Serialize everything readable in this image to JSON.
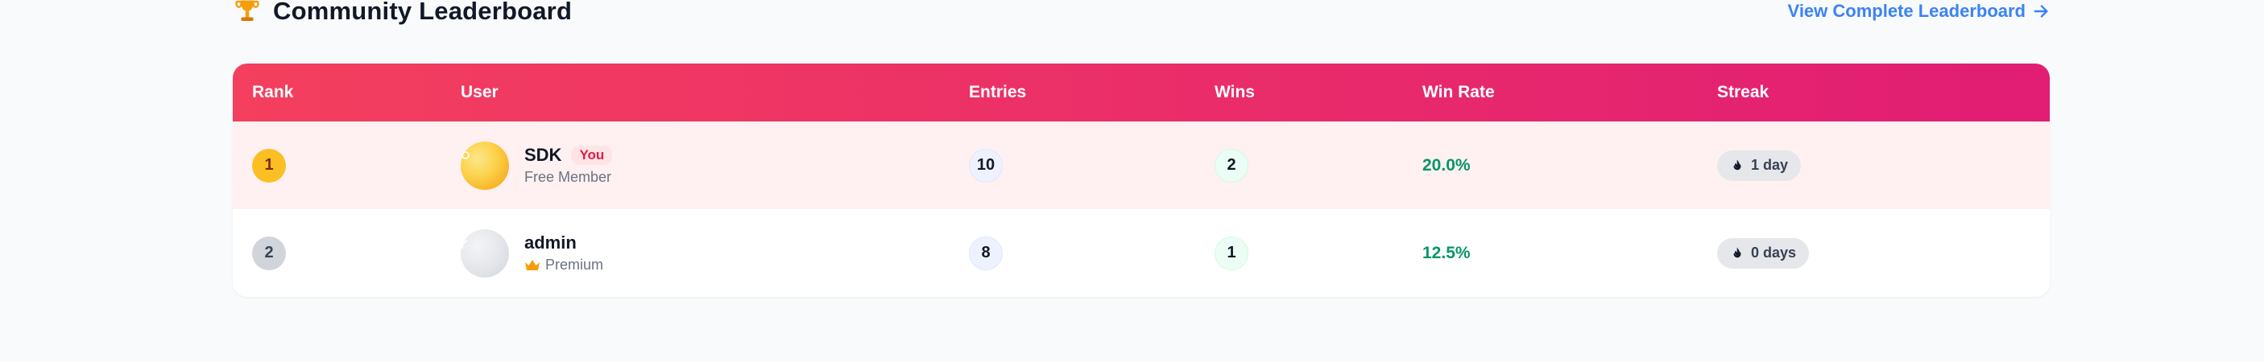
{
  "header": {
    "title": "Community Leaderboard",
    "view_all_label": "View Complete Leaderboard"
  },
  "table": {
    "columns": {
      "rank": "Rank",
      "user": "User",
      "entries": "Entries",
      "wins": "Wins",
      "win_rate": "Win Rate",
      "streak": "Streak"
    },
    "rows": [
      {
        "rank": "1",
        "username": "SDK",
        "you_label": "You",
        "membership": "Free Member",
        "entries": "10",
        "wins": "2",
        "win_rate": "20.0%",
        "streak": "1 day"
      },
      {
        "rank": "2",
        "username": "admin",
        "membership": "Premium",
        "entries": "8",
        "wins": "1",
        "win_rate": "12.5%",
        "streak": "0 days"
      }
    ]
  },
  "colors": {
    "header_gradient_start": "#f43f5e",
    "header_gradient_end": "#e11d74",
    "highlight_row": "#fff1f2",
    "link": "#3b82f6",
    "win_rate": "#059669",
    "gold": "#fbbf24",
    "silver": "#d1d5db"
  },
  "icons": {
    "title": "trophy-icon",
    "link": "arrow-right-icon",
    "premium": "crown-icon",
    "streak": "flame-icon"
  }
}
